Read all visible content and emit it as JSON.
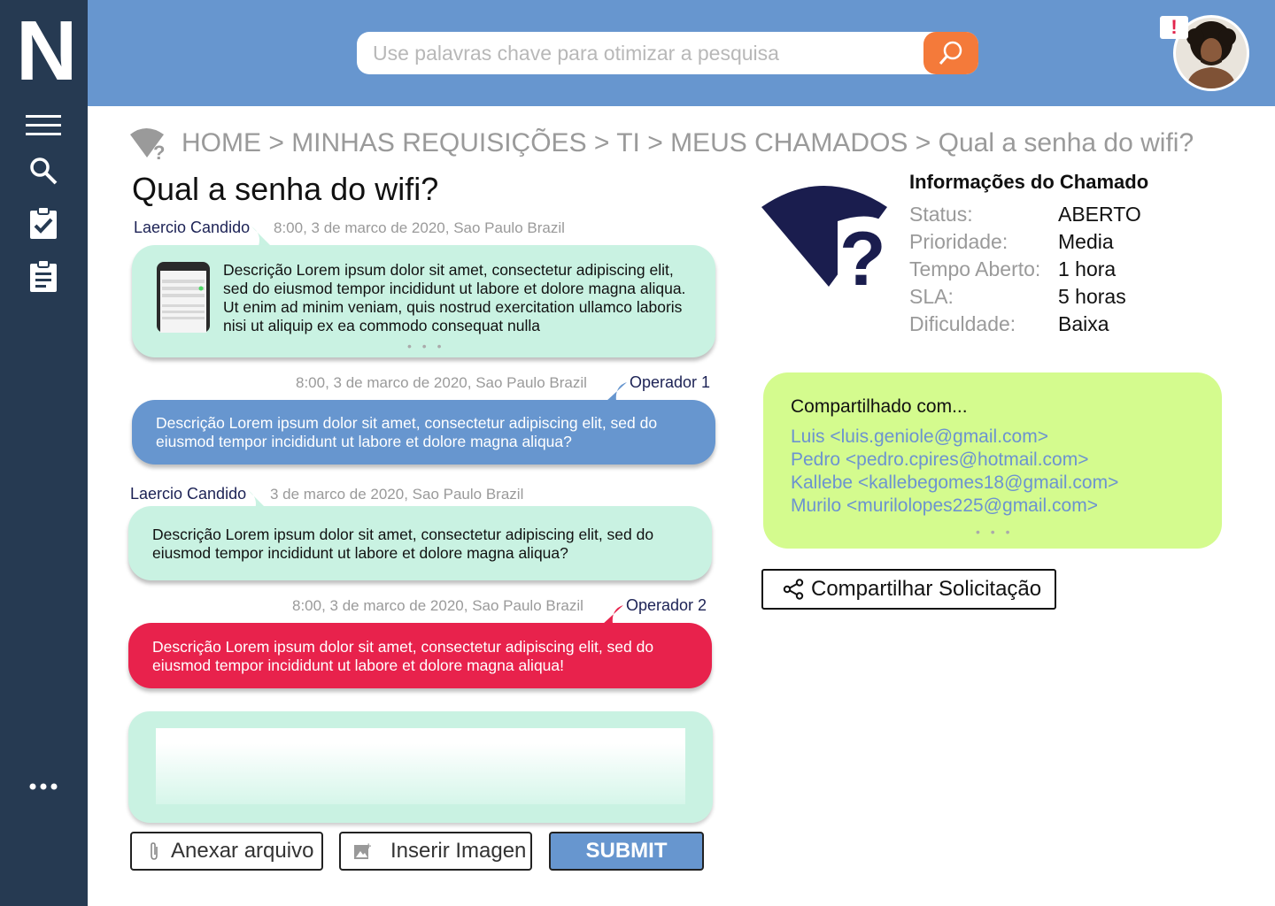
{
  "app": {
    "logo": "N"
  },
  "sidebar": {
    "items": [
      {
        "icon": "menu-icon"
      },
      {
        "icon": "search-icon"
      },
      {
        "icon": "task-check-icon"
      },
      {
        "icon": "clipboard-icon"
      },
      {
        "icon": "more-icon"
      }
    ]
  },
  "header": {
    "search_placeholder": "Use palavras chave para otimizar a pesquisa",
    "alert": "!"
  },
  "breadcrumb": {
    "text": "HOME > MINHAS REQUISIÇÕES > TI > MEUS CHAMADOS > Qual a senha do wifi?"
  },
  "ticket": {
    "title": "Qual a senha do wifi?"
  },
  "messages": [
    {
      "author": "Laercio Candido",
      "meta": "8:00, 3 de marco de 2020, Sao Paulo Brazil",
      "text": "Descrição Lorem ipsum dolor sit amet, consectetur adipiscing elit, sed do eiusmod tempor incididunt ut labore et dolore magna aliqua. Ut enim ad minim veniam, quis nostrud exercitation ullamco laboris nisi ut aliquip ex ea commodo consequat nulla",
      "more": "• • •",
      "color": "#c9f2e2"
    },
    {
      "author": "Operador 1",
      "meta": "8:00, 3 de marco de 2020, Sao Paulo Brazil",
      "text": "Descrição Lorem ipsum dolor sit amet, consectetur adipiscing elit, sed do eiusmod tempor incididunt ut labore et dolore magna aliqua?",
      "color": "#6796cf"
    },
    {
      "author": "Laercio Candido",
      "meta": "3 de marco de 2020, Sao Paulo Brazil",
      "text": "Descrição Lorem ipsum dolor sit amet, consectetur adipiscing elit, sed do eiusmod tempor incididunt ut labore et dolore magna aliqua?",
      "color": "#c9f2e2"
    },
    {
      "author": "Operador 2",
      "meta": "8:00, 3 de marco de 2020, Sao Paulo Brazil",
      "text": "Descrição Lorem ipsum dolor sit amet, consectetur adipiscing elit, sed do eiusmod tempor incididunt ut labore et dolore magna aliqua!",
      "color": "#e8224c"
    }
  ],
  "info": {
    "title": "Informações do Chamado",
    "rows": [
      {
        "label": "Status:",
        "value": "ABERTO"
      },
      {
        "label": "Prioridade:",
        "value": "Media"
      },
      {
        "label": "Tempo Aberto:",
        "value": "1 hora"
      },
      {
        "label": "SLA:",
        "value": "5 horas"
      },
      {
        "label": "Dificuldade:",
        "value": "Baixa"
      }
    ]
  },
  "shared": {
    "title": "Compartilhado com...",
    "people": [
      "Luis <luis.geniole@gmail.com>",
      "Pedro <pedro.cpires@hotmail.com>",
      "Kallebe <kallebegomes18@gmail.com>",
      "Murilo <murilolopes225@gmail.com>"
    ],
    "more": "• • •",
    "share_button": "Compartilhar Solicitação"
  },
  "composer": {
    "attach_label": "Anexar arquivo",
    "image_label": "Inserir Imagen",
    "submit_label": "SUBMIT"
  },
  "colors": {
    "sidebar": "#263a52",
    "topbar": "#6796cf",
    "search_button": "#f47a3a",
    "user_bubble": "#c9f2e2",
    "operator1_bubble": "#6796cf",
    "operator2_bubble": "#e8224c",
    "shared_box": "#d4fb8e",
    "icon_navy": "#1a1d4e"
  }
}
